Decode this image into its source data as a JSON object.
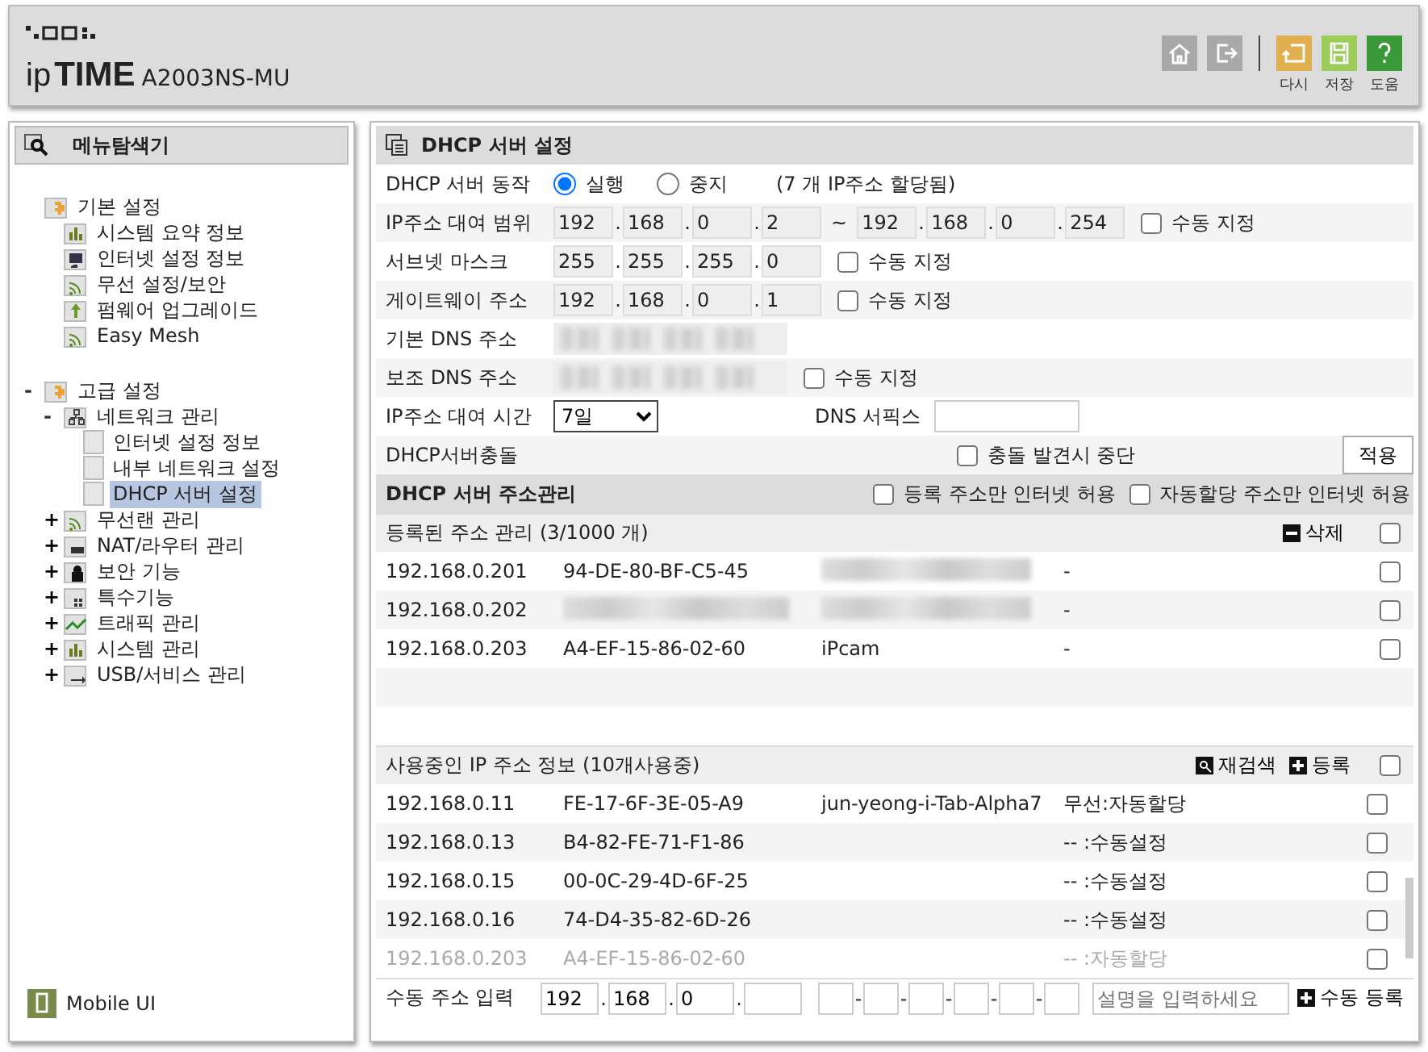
{
  "header": {
    "logo_prefix": "ip",
    "logo_brand": "TIME",
    "model": "A2003NS-MU",
    "buttons": [
      {
        "kind": "home"
      },
      {
        "kind": "logout"
      },
      {
        "kind": "undo",
        "label": "다시"
      },
      {
        "kind": "save",
        "label": "저장"
      },
      {
        "kind": "help",
        "label": "도움"
      }
    ]
  },
  "sidebar": {
    "title": "메뉴탐색기",
    "tree": [
      {
        "label": "기본 설정",
        "kind": "folder",
        "selected": false,
        "children": [
          {
            "label": "시스템 요약 정보",
            "kind": "chart",
            "selected": false
          },
          {
            "label": "인터넷 설정 정보",
            "kind": "monitor",
            "selected": false
          },
          {
            "label": "무선 설정/보안",
            "kind": "wifi",
            "selected": false
          },
          {
            "label": "펌웨어 업그레이드",
            "kind": "upload",
            "selected": false
          },
          {
            "label": "Easy Mesh",
            "kind": "wifi",
            "selected": false
          }
        ]
      },
      {
        "label": "고급 설정",
        "kind": "folder",
        "expanded": true,
        "toggle": "-",
        "selected": false,
        "children": [
          {
            "label": "네트워크 관리",
            "kind": "network",
            "expanded": true,
            "toggle": "-",
            "selected": false,
            "children": [
              {
                "label": "인터넷 설정 정보",
                "kind": "page",
                "selected": false
              },
              {
                "label": "내부 네트워크 설정",
                "kind": "page",
                "selected": false
              },
              {
                "label": "DHCP 서버 설정",
                "kind": "page",
                "selected": true
              }
            ]
          },
          {
            "label": "무선랜 관리",
            "kind": "wifi",
            "expanded": false,
            "toggle": "+",
            "selected": false
          },
          {
            "label": "NAT/라우터 관리",
            "kind": "nat",
            "expanded": false,
            "toggle": "+",
            "selected": false
          },
          {
            "label": "보안 기능",
            "kind": "lock",
            "expanded": false,
            "toggle": "+",
            "selected": false
          },
          {
            "label": "특수기능",
            "kind": "special",
            "expanded": false,
            "toggle": "+",
            "selected": false
          },
          {
            "label": "트래픽 관리",
            "kind": "traffic",
            "expanded": false,
            "toggle": "+",
            "selected": false
          },
          {
            "label": "시스템 관리",
            "kind": "chart",
            "expanded": false,
            "toggle": "+",
            "selected": false
          },
          {
            "label": "USB/서비스 관리",
            "kind": "usb",
            "expanded": false,
            "toggle": "+",
            "selected": false
          }
        ]
      }
    ],
    "footer": "Mobile UI"
  },
  "main": {
    "title": "DHCP 서버 설정",
    "octet_separator": ".",
    "mac_separator": "-",
    "settings": [
      {
        "kind": "radio",
        "label": "DHCP 서버 동작",
        "options": [
          {
            "label": "실행",
            "selected": true
          },
          {
            "label": "중지",
            "selected": false
          }
        ],
        "note": "(7 개 IP주소 할당됨)"
      },
      {
        "kind": "range",
        "label": "IP주소 대여 범위",
        "from": [
          "192",
          "168",
          "0",
          "2"
        ],
        "separator": "~",
        "to": [
          "192",
          "168",
          "0",
          "254"
        ],
        "check": {
          "label": "수동 지정",
          "checked": false
        }
      },
      {
        "kind": "ip",
        "label": "서브넷 마스크",
        "octets": [
          "255",
          "255",
          "255",
          "0"
        ],
        "check": {
          "label": "수동 지정",
          "checked": false
        }
      },
      {
        "kind": "ip",
        "label": "게이트웨이 주소",
        "octets": [
          "192",
          "168",
          "0",
          "1"
        ],
        "check": {
          "label": "수동 지정",
          "checked": false
        }
      },
      {
        "kind": "blurred",
        "label": "기본 DNS 주소"
      },
      {
        "kind": "blurred",
        "label": "보조 DNS 주소",
        "check": {
          "label": "수동 지정",
          "checked": false
        }
      },
      {
        "kind": "lease",
        "label": "IP주소 대여 시간",
        "value": "7일",
        "suffix_label": "DNS 서픽스"
      },
      {
        "kind": "conflict",
        "label": "DHCP서버충돌",
        "check": {
          "label": "충돌 발견시 중단",
          "checked": false
        },
        "button": "적용"
      }
    ],
    "management": {
      "title": "DHCP 서버 주소관리",
      "options": [
        {
          "label": "등록 주소만 인터넷 허용",
          "checked": false
        },
        {
          "label": "자동할당 주소만 인터넷 허용",
          "checked": false
        }
      ]
    },
    "registered": {
      "title": "등록된 주소 관리 (3/1000 개)",
      "action": "삭제",
      "all_checked": false,
      "rows": [
        {
          "ip": "192.168.0.201",
          "mac": "94-DE-80-BF-C5-45",
          "name": {
            "kind": "blurred"
          },
          "note": "-",
          "checked": false
        },
        {
          "ip": "192.168.0.202",
          "mac": {
            "kind": "blurred"
          },
          "name": {
            "kind": "blurred"
          },
          "note": "-",
          "checked": false
        },
        {
          "ip": "192.168.0.203",
          "mac": "A4-EF-15-86-02-60",
          "name": "iPcam",
          "note": "-",
          "checked": false
        }
      ]
    },
    "in_use": {
      "title": "사용중인 IP 주소 정보 (10개사용중)",
      "actions": [
        {
          "kind": "search",
          "label": "재검색"
        },
        {
          "kind": "add",
          "label": "등록"
        }
      ],
      "all_checked": false,
      "rows": [
        {
          "ip": "192.168.0.11",
          "mac": "FE-17-6F-3E-05-A9",
          "name": "jun-yeong-i-Tab-Alpha7",
          "note": "무선:자동할당",
          "checked": false,
          "disabled": false
        },
        {
          "ip": "192.168.0.13",
          "mac": "B4-82-FE-71-F1-86",
          "note": "-- :수동설정",
          "checked": false,
          "disabled": false
        },
        {
          "ip": "192.168.0.15",
          "mac": "00-0C-29-4D-6F-25",
          "note": "-- :수동설정",
          "checked": false,
          "disabled": false
        },
        {
          "ip": "192.168.0.16",
          "mac": "74-D4-35-82-6D-26",
          "note": "-- :수동설정",
          "checked": false,
          "disabled": false
        },
        {
          "ip": "192.168.0.203",
          "mac": "A4-EF-15-86-02-60",
          "note": "-- :자동할당",
          "checked": false,
          "disabled": true
        }
      ]
    },
    "manual": {
      "label": "수동 주소 입력",
      "octets": [
        "192",
        "168",
        "0"
      ],
      "placeholder": "설명을 입력하세요",
      "button": "수동 등록"
    }
  }
}
